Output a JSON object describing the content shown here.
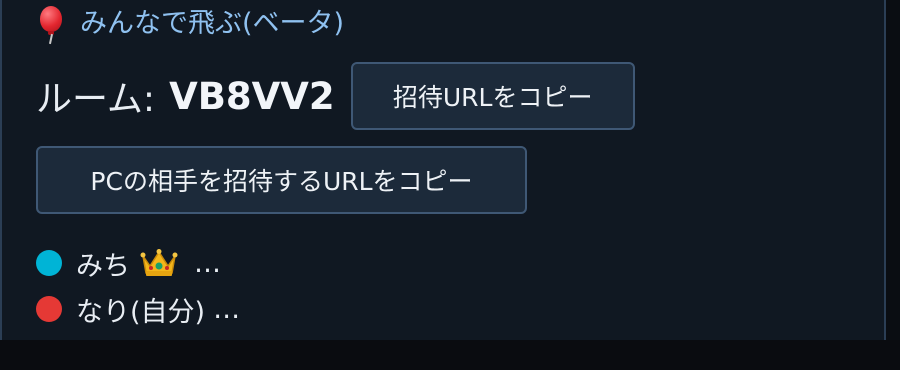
{
  "app": {
    "title": "みんなで飛ぶ(ベータ)",
    "title_icon": "balloon-icon"
  },
  "room": {
    "label": "ルーム:",
    "code": "VB8VV2"
  },
  "buttons": {
    "copy_invite": "招待URLをコピー",
    "copy_pc_invite": "PCの相手を招待するURLをコピー"
  },
  "users": [
    {
      "name": "みち",
      "color": "#00b4d6",
      "badge": "crown-icon",
      "status": "…"
    },
    {
      "name": "なり(自分)",
      "color": "#e53935",
      "status": "…"
    }
  ],
  "colors": {
    "panel_bg": "#101822",
    "accent_title": "#8fc1f0",
    "button_bg": "#1c2a3a",
    "button_border": "#3f5875"
  }
}
